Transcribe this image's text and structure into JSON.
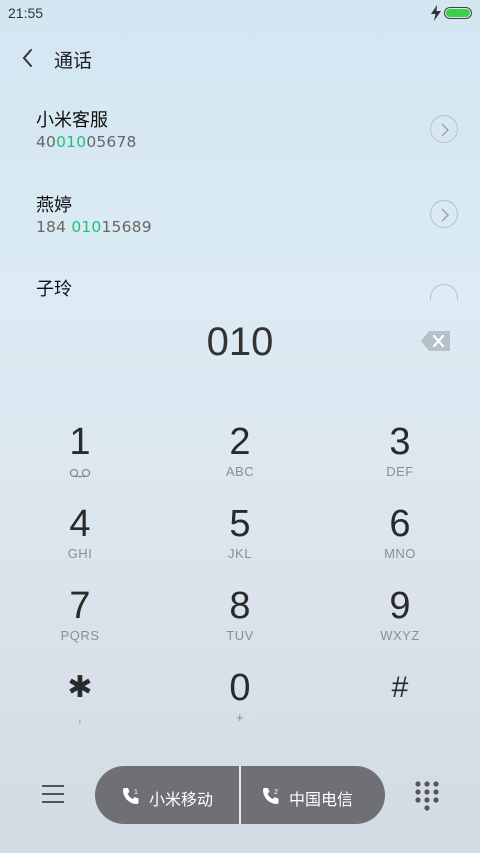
{
  "status_bar": {
    "time": "21:55",
    "battery_percent": 100,
    "charging": true
  },
  "header": {
    "title": "通话",
    "back_icon": "chevron-left-icon"
  },
  "contacts": [
    {
      "name": "小米客服",
      "number_prefix": "40",
      "number_match": "010",
      "number_suffix": "05678"
    },
    {
      "name": "燕婷",
      "number_prefix": "184 ",
      "number_match": "010",
      "number_suffix": "15689"
    },
    {
      "name": "子玲",
      "number_prefix": "",
      "number_match": "",
      "number_suffix": ""
    }
  ],
  "dialer": {
    "entered_number": "010",
    "backspace_icon": "backspace-icon",
    "keys": [
      {
        "digit": "1",
        "letters": ""
      },
      {
        "digit": "2",
        "letters": "ABC"
      },
      {
        "digit": "3",
        "letters": "DEF"
      },
      {
        "digit": "4",
        "letters": "GHI"
      },
      {
        "digit": "5",
        "letters": "JKL"
      },
      {
        "digit": "6",
        "letters": "MNO"
      },
      {
        "digit": "7",
        "letters": "PQRS"
      },
      {
        "digit": "8",
        "letters": "TUV"
      },
      {
        "digit": "9",
        "letters": "WXYZ"
      },
      {
        "digit": "✱",
        "letters": ","
      },
      {
        "digit": "0",
        "letters": "+"
      },
      {
        "digit": "#",
        "letters": ""
      }
    ]
  },
  "bottom_bar": {
    "menu_icon": "menu-icon",
    "sim1_label": "小米移动",
    "sim2_label": "中国电信",
    "keypad_icon": "keypad-grid-icon"
  },
  "colors": {
    "match_highlight": "#20c080",
    "call_button_bg": "#6e7073",
    "battery": "#3bd04a"
  }
}
